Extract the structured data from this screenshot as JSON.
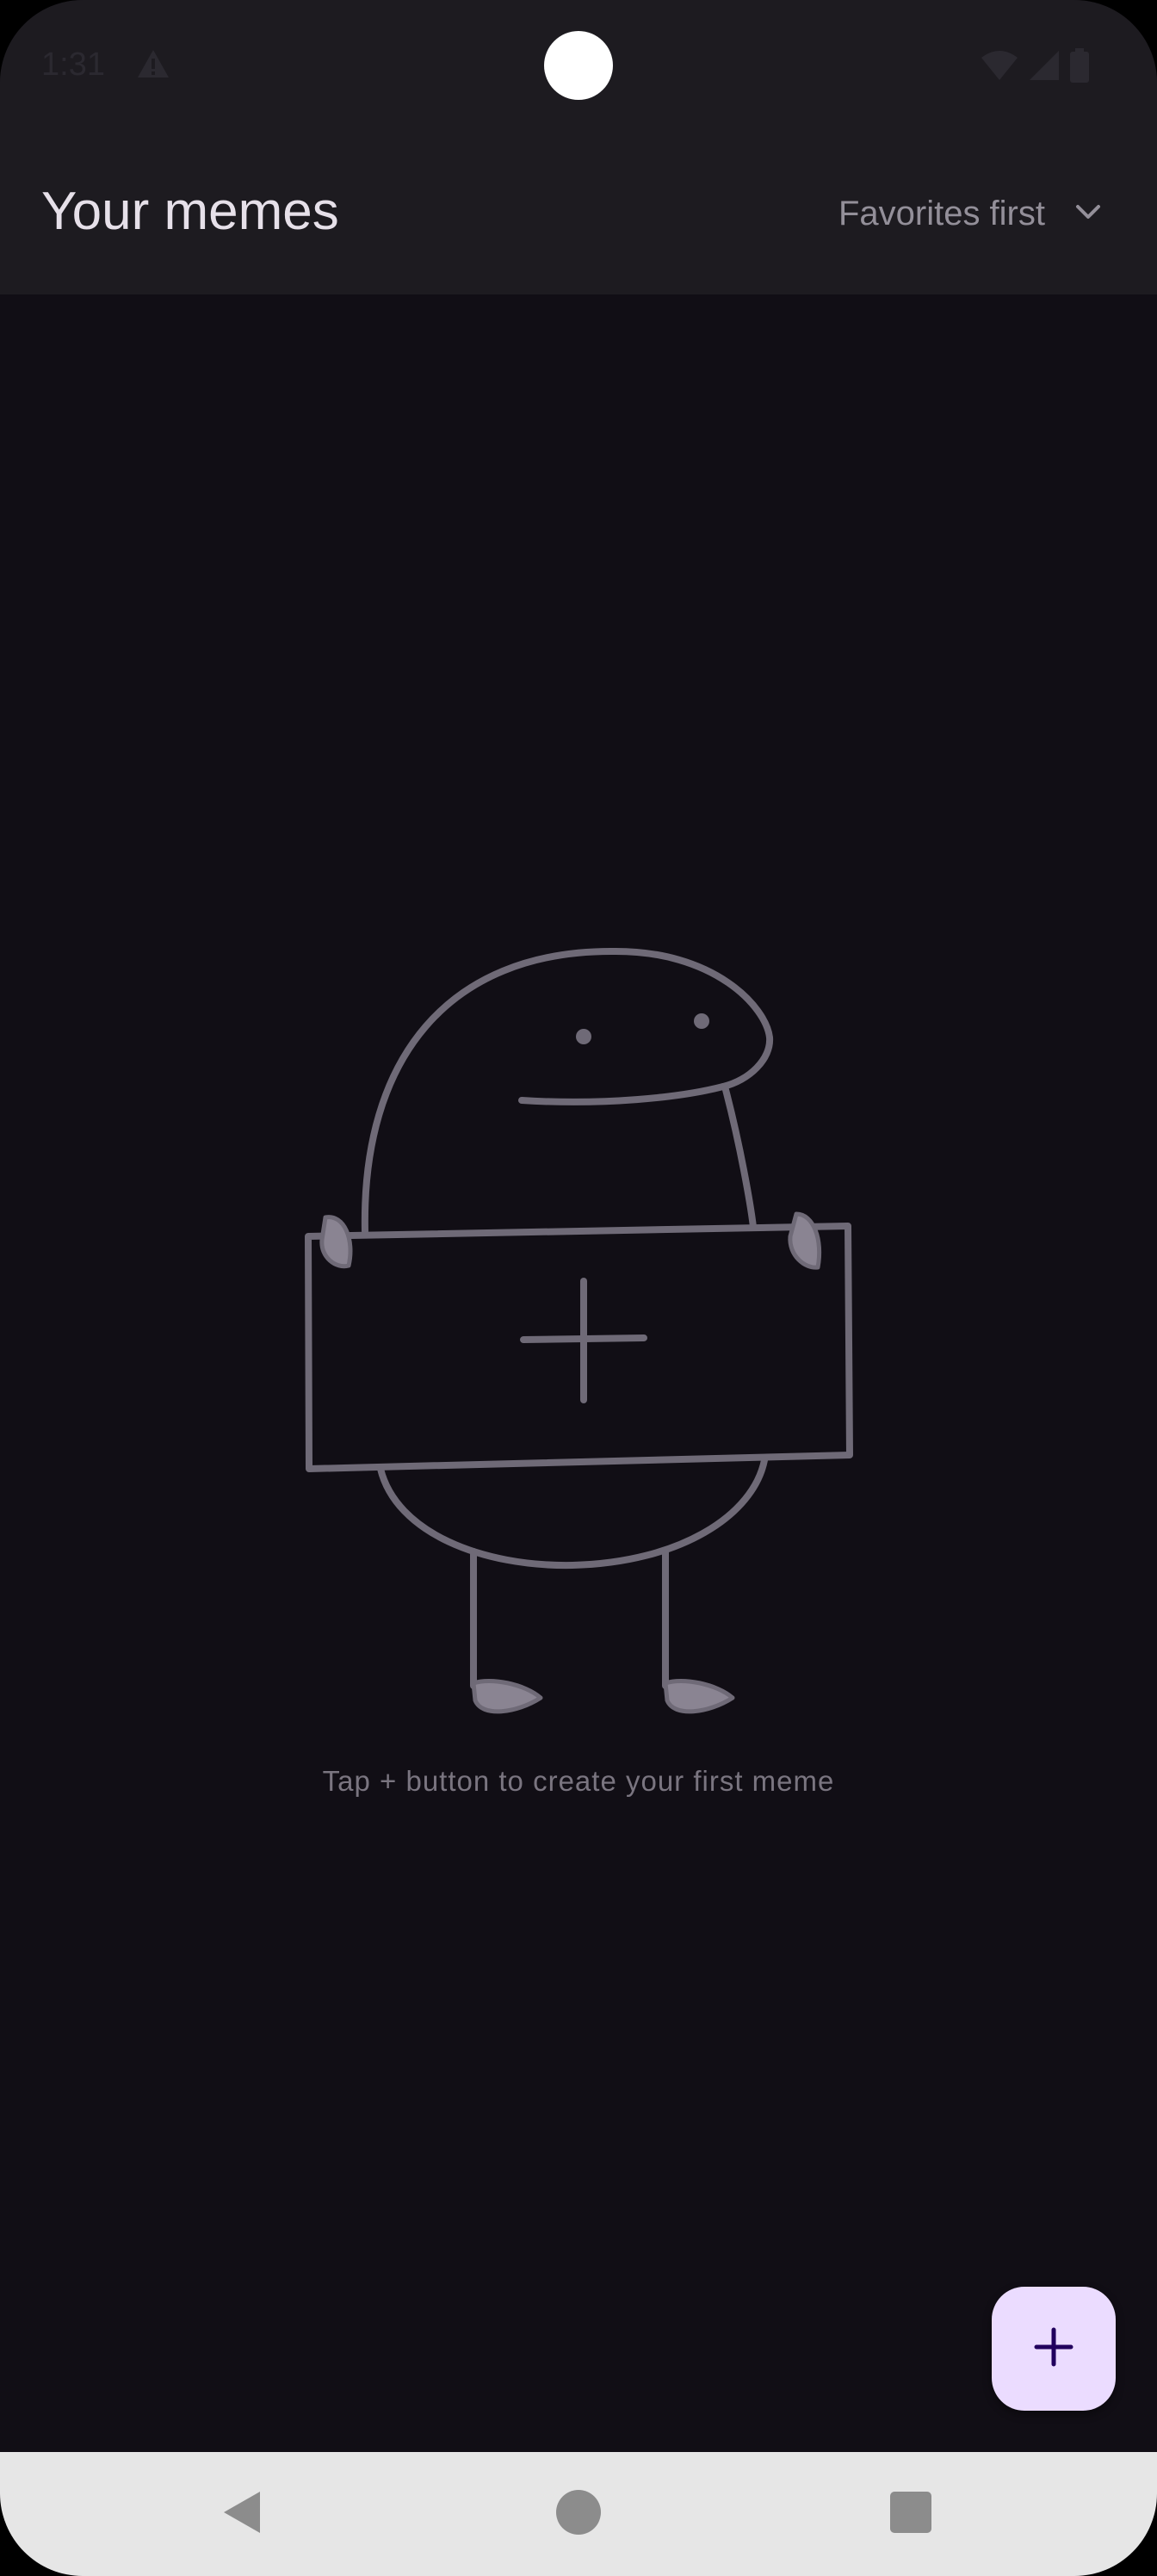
{
  "status_bar": {
    "time": "1:31",
    "icons": [
      "warning-icon",
      "wifi-icon",
      "signal-icon",
      "battery-icon"
    ]
  },
  "app_bar": {
    "title": "Your memes",
    "sort": {
      "selected": "Favorites first",
      "icon": "chevron-down-icon"
    }
  },
  "empty_state": {
    "message": "Tap + button to create your first meme",
    "illustration": "creature-holding-plus-sign"
  },
  "fab": {
    "icon": "plus-icon"
  },
  "nav_bar": {
    "buttons": [
      "back-icon",
      "home-icon",
      "recents-icon"
    ]
  },
  "colors": {
    "background": "#110e15",
    "app_bar": "#1d1b20",
    "title_text": "#e6e0e9",
    "muted_text": "#938f99",
    "illustration_stroke": "#6f6a77",
    "fab": "#ebdcff",
    "fab_icon": "#21005d",
    "nav_bar": "#e6e6e6"
  }
}
